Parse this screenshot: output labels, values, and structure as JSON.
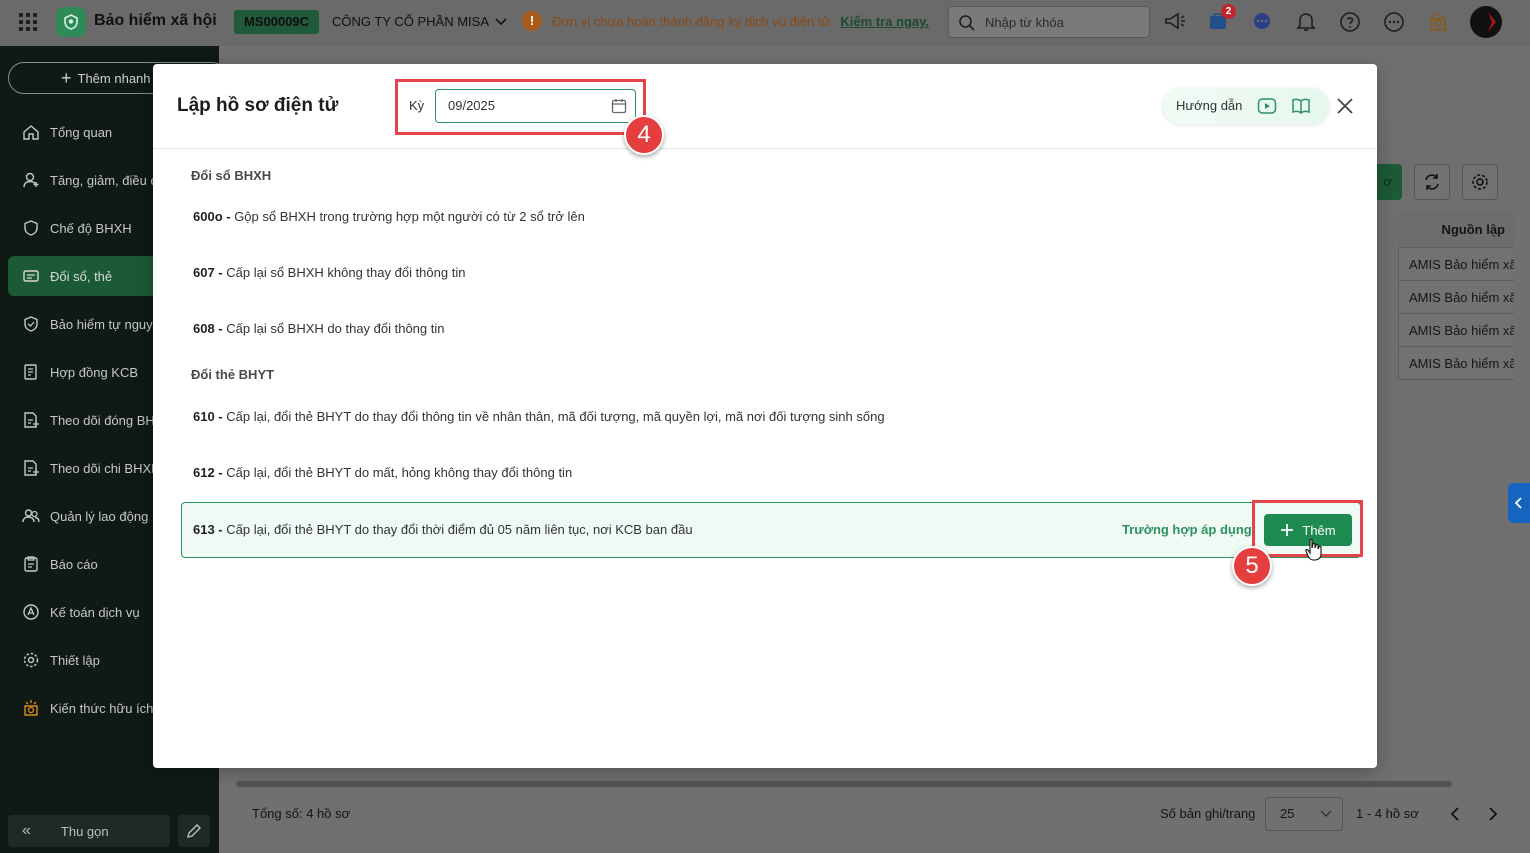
{
  "topbar": {
    "app_name": "Bảo hiểm xã hội",
    "tenant_code": "MS00009C",
    "company": "CÔNG TY CỔ PHẦN MISA",
    "warning_text": "Đơn vị chưa hoàn thành đăng ký dịch vụ điện tử.",
    "warning_link": "Kiểm tra ngay.",
    "search_placeholder": "Nhập từ khóa",
    "cart_badge": "2"
  },
  "sidebar": {
    "quick_add": "Thêm nhanh",
    "items": [
      {
        "label": "Tổng quan",
        "icon": "home-icon"
      },
      {
        "label": "Tăng, giảm, điều chỉnh",
        "icon": "user-icon"
      },
      {
        "label": "Chế độ BHXH",
        "icon": "shield-heart-icon"
      },
      {
        "label": "Đổi sổ, thẻ",
        "icon": "card-icon",
        "active": true
      },
      {
        "label": "Bảo hiểm tự nguyện",
        "icon": "shield-icon"
      },
      {
        "label": "Hợp đồng KCB",
        "icon": "contract-icon"
      },
      {
        "label": "Theo dõi đóng BHXH",
        "icon": "doc-plus-icon"
      },
      {
        "label": "Theo dõi chi BHXH",
        "icon": "doc-plus-icon"
      },
      {
        "label": "Quản lý lao động",
        "icon": "users-icon"
      },
      {
        "label": "Báo cáo",
        "icon": "report-icon"
      },
      {
        "label": "Kế toán dịch vụ",
        "icon": "accounting-icon"
      },
      {
        "label": "Thiết lập",
        "icon": "gear-icon"
      },
      {
        "label": "Kiến thức hữu ích",
        "icon": "bulb-icon"
      }
    ],
    "collapse_label": "Thu gọn"
  },
  "background": {
    "green_button_fragment": "ơ",
    "column_header": "Nguồn lập",
    "rows": [
      "AMIS Bảo hiểm xã hội",
      "AMIS Bảo hiểm xã hội",
      "AMIS Bảo hiểm xã hội",
      "AMIS Bảo hiểm xã hội"
    ],
    "total": "Tổng số: 4 hồ sơ",
    "per_page_label": "Số bản ghi/trang",
    "per_page_value": "25",
    "range": "1 - 4 hồ sơ"
  },
  "modal": {
    "title": "Lập hồ sơ điện tử",
    "period_label": "Kỳ",
    "period_value": "09/2025",
    "guide_label": "Hướng dẫn",
    "step_markers": [
      "4",
      "5"
    ],
    "groups": [
      {
        "title": "Đổi sổ BHXH",
        "items": [
          {
            "code": "600o - ",
            "desc": "Gộp sổ BHXH trong trường hợp một người có từ 2 sổ trở lên"
          },
          {
            "code": "607 - ",
            "desc": "Cấp lại sổ BHXH không thay đổi thông tin"
          },
          {
            "code": "608 - ",
            "desc": "Cấp lại sổ BHXH do thay đổi thông tin"
          }
        ]
      },
      {
        "title": "Đổi thẻ BHYT",
        "items": [
          {
            "code": "610 - ",
            "desc": "Cấp lại, đổi thẻ BHYT do thay đổi thông tin về nhân thân, mã đối tượng, mã quyền lợi, mã nơi đối tượng sinh sống"
          },
          {
            "code": "612 - ",
            "desc": "Cấp lại, đổi thẻ BHYT do mất, hỏng không thay đổi thông tin"
          },
          {
            "code": "613 - ",
            "desc": "Cấp lại, đổi thẻ BHYT do thay đổi thời điểm đủ 05 năm liên tục, nơi KCB ban đầu"
          }
        ]
      }
    ],
    "apply_link": "Trường hợp áp dụng",
    "add_label": "Thêm"
  },
  "colors": {
    "brand_green": "#1e8a50",
    "highlight_red": "#e5434a",
    "hover_bg": "#effaf4"
  }
}
